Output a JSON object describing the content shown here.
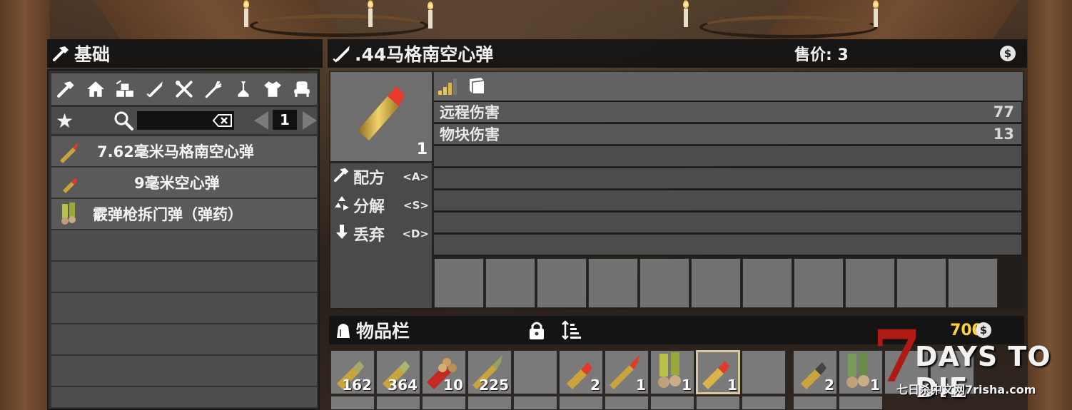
{
  "craft": {
    "title": "基础",
    "categories": [
      "hammer-icon",
      "house-icon",
      "blocks-icon",
      "ammo-icon",
      "tools-icon",
      "fork-icon",
      "science-icon",
      "shirt-icon",
      "chair-icon"
    ],
    "page": "1",
    "recipes": [
      {
        "label": "7.62毫米马格南空心弹"
      },
      {
        "label": "9毫米空心弹"
      },
      {
        "label": "霰弹枪拆门弹（弹药）"
      }
    ]
  },
  "item": {
    "title": ".44马格南空心弹",
    "price_label": "售价: 3",
    "count": "1",
    "actions": [
      {
        "label": "配方",
        "key": "<A>",
        "icon": "hammer-icon"
      },
      {
        "label": "分解",
        "key": "<S>",
        "icon": "recycle-icon"
      },
      {
        "label": "丢弃",
        "key": "<D>",
        "icon": "drop-icon"
      }
    ],
    "stats": [
      {
        "name": "远程伤害",
        "value": "77"
      },
      {
        "name": "物块伤害",
        "value": "13"
      }
    ]
  },
  "inventory": {
    "title": "物品栏",
    "money": "700",
    "slots": [
      {
        "qty": "162",
        "icon": "bullet-icon"
      },
      {
        "qty": "364",
        "icon": "bullet-icon"
      },
      {
        "qty": "10",
        "icon": "shotgun-shell-icon"
      },
      {
        "qty": "225",
        "icon": "rifle-round-icon"
      },
      {
        "qty": "",
        "icon": ""
      },
      {
        "qty": "2",
        "icon": "hollow-point-icon"
      },
      {
        "qty": "1",
        "icon": "rifle-round-icon"
      },
      {
        "qty": "1",
        "icon": "shotgun-shell-icon"
      },
      {
        "qty": "1",
        "icon": "hollow-point-icon",
        "selected": true
      },
      {
        "qty": "",
        "icon": ""
      },
      {
        "qty": "2",
        "icon": "bullet-icon"
      },
      {
        "qty": "1",
        "icon": "shotgun-shell-icon"
      },
      {
        "qty": "",
        "icon": ""
      },
      {
        "qty": "",
        "icon": ""
      }
    ]
  },
  "logo": {
    "number": "7",
    "title": "DAYS TO DIE",
    "subtitle": "七日杀中文网7risha.com"
  },
  "colors": {
    "money": "#ffd23a",
    "logo_red": "#b01a14"
  }
}
